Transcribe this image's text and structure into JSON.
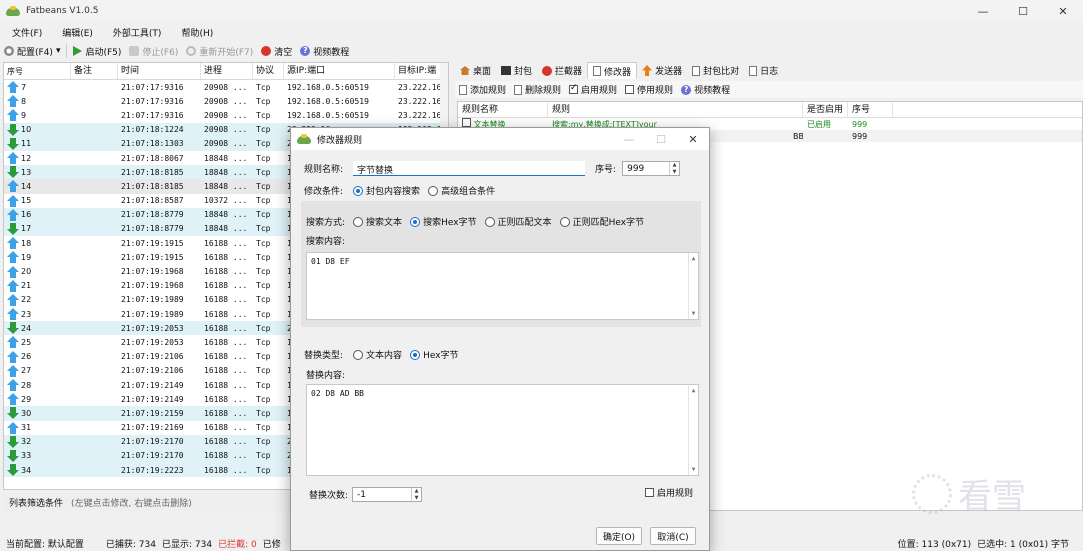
{
  "window": {
    "title": "Fatbeans V1.0.5",
    "minimize_icon": "minimize-icon",
    "maximize_icon": "maximize-icon",
    "close_icon": "close-icon"
  },
  "menu": [
    "文件(F)",
    "编辑(E)",
    "外部工具(T)",
    "帮助(H)"
  ],
  "toolbar": {
    "config": "配置(F4)",
    "start": "启动(F5)",
    "stop": "停止(F6)",
    "restart": "重新开始(F7)",
    "clear": "清空",
    "tutorial": "视频教程"
  },
  "packets": {
    "headers": [
      "序号",
      "备注",
      "时间",
      "进程",
      "协议",
      "源IP:端口",
      "目标IP:端"
    ],
    "rows": [
      {
        "no": "7",
        "dir": "up",
        "time": "21:07:17:9316",
        "proc": "20908 ...",
        "proto": "Tcp",
        "src": "192.168.0.5:60519",
        "dst": "23.222.16"
      },
      {
        "no": "8",
        "dir": "up",
        "time": "21:07:17:9316",
        "proc": "20908 ...",
        "proto": "Tcp",
        "src": "192.168.0.5:60519",
        "dst": "23.222.16"
      },
      {
        "no": "9",
        "dir": "up",
        "time": "21:07:17:9316",
        "proc": "20908 ...",
        "proto": "Tcp",
        "src": "192.168.0.5:60519",
        "dst": "23.222.16"
      },
      {
        "no": "10",
        "dir": "down",
        "time": "21:07:18:1224",
        "proc": "20908 ...",
        "proto": "Tcp",
        "src": "23.222.16",
        "dst": "192.168.0"
      },
      {
        "no": "11",
        "dir": "down",
        "time": "21:07:18:1303",
        "proc": "20908 ...",
        "proto": "Tcp",
        "src": "2",
        "dst": ""
      },
      {
        "no": "12",
        "dir": "up",
        "time": "21:07:18:8067",
        "proc": "18848 ...",
        "proto": "Tcp",
        "src": "1",
        "dst": ""
      },
      {
        "no": "13",
        "dir": "down",
        "time": "21:07:18:8185",
        "proc": "18848 ...",
        "proto": "Tcp",
        "src": "1",
        "dst": ""
      },
      {
        "no": "14",
        "dir": "up",
        "time": "21:07:18:8185",
        "proc": "18848 ...",
        "proto": "Tcp",
        "src": "1",
        "dst": ""
      },
      {
        "no": "15",
        "dir": "up",
        "time": "21:07:18:8587",
        "proc": "10372 ...",
        "proto": "Tcp",
        "src": "1",
        "dst": ""
      },
      {
        "no": "16",
        "dir": "up",
        "time": "21:07:18:8779",
        "proc": "18848 ...",
        "proto": "Tcp",
        "src": "1",
        "dst": ""
      },
      {
        "no": "17",
        "dir": "down",
        "time": "21:07:18:8779",
        "proc": "18848 ...",
        "proto": "Tcp",
        "src": "1",
        "dst": ""
      },
      {
        "no": "18",
        "dir": "up",
        "time": "21:07:19:1915",
        "proc": "16188 ...",
        "proto": "Tcp",
        "src": "1",
        "dst": ""
      },
      {
        "no": "19",
        "dir": "up",
        "time": "21:07:19:1915",
        "proc": "16188 ...",
        "proto": "Tcp",
        "src": "1",
        "dst": ""
      },
      {
        "no": "20",
        "dir": "up",
        "time": "21:07:19:1968",
        "proc": "16188 ...",
        "proto": "Tcp",
        "src": "1",
        "dst": ""
      },
      {
        "no": "21",
        "dir": "up",
        "time": "21:07:19:1968",
        "proc": "16188 ...",
        "proto": "Tcp",
        "src": "1",
        "dst": ""
      },
      {
        "no": "22",
        "dir": "up",
        "time": "21:07:19:1989",
        "proc": "16188 ...",
        "proto": "Tcp",
        "src": "1",
        "dst": ""
      },
      {
        "no": "23",
        "dir": "up",
        "time": "21:07:19:1989",
        "proc": "16188 ...",
        "proto": "Tcp",
        "src": "1",
        "dst": ""
      },
      {
        "no": "24",
        "dir": "down",
        "time": "21:07:19:2053",
        "proc": "16188 ...",
        "proto": "Tcp",
        "src": "2",
        "dst": ""
      },
      {
        "no": "25",
        "dir": "up",
        "time": "21:07:19:2053",
        "proc": "16188 ...",
        "proto": "Tcp",
        "src": "1",
        "dst": ""
      },
      {
        "no": "26",
        "dir": "up",
        "time": "21:07:19:2106",
        "proc": "16188 ...",
        "proto": "Tcp",
        "src": "1",
        "dst": ""
      },
      {
        "no": "27",
        "dir": "up",
        "time": "21:07:19:2106",
        "proc": "16188 ...",
        "proto": "Tcp",
        "src": "1",
        "dst": ""
      },
      {
        "no": "28",
        "dir": "up",
        "time": "21:07:19:2149",
        "proc": "16188 ...",
        "proto": "Tcp",
        "src": "1",
        "dst": ""
      },
      {
        "no": "29",
        "dir": "up",
        "time": "21:07:19:2149",
        "proc": "16188 ...",
        "proto": "Tcp",
        "src": "1",
        "dst": ""
      },
      {
        "no": "30",
        "dir": "down",
        "time": "21:07:19:2159",
        "proc": "16188 ...",
        "proto": "Tcp",
        "src": "1",
        "dst": ""
      },
      {
        "no": "31",
        "dir": "up",
        "time": "21:07:19:2169",
        "proc": "16188 ...",
        "proto": "Tcp",
        "src": "1",
        "dst": ""
      },
      {
        "no": "32",
        "dir": "down",
        "time": "21:07:19:2170",
        "proc": "16188 ...",
        "proto": "Tcp",
        "src": "2",
        "dst": ""
      },
      {
        "no": "33",
        "dir": "down",
        "time": "21:07:19:2170",
        "proc": "16188 ...",
        "proto": "Tcp",
        "src": "2",
        "dst": ""
      },
      {
        "no": "34",
        "dir": "down",
        "time": "21:07:19:2223",
        "proc": "16188 ...",
        "proto": "Tcp",
        "src": "1",
        "dst": ""
      }
    ]
  },
  "filter": {
    "label": "列表筛选条件",
    "hint": "(左键点击修改, 右键点击删除)"
  },
  "tabs": [
    "桌面",
    "封包",
    "拦截器",
    "修改器",
    "发送器",
    "封包比对",
    "日志"
  ],
  "rule_toolbar": {
    "add": "添加规则",
    "delete": "删除规则",
    "enable": "启用规则",
    "disable": "停用规则",
    "tutorial": "视频教程"
  },
  "rules": {
    "headers": [
      "规则名称",
      "规则",
      "是否启用",
      "序号"
    ],
    "rows": [
      {
        "name": "文本替换",
        "rule": "搜索:my,替换成:[TEXT]your",
        "enabled": "已启用",
        "seq": "999"
      },
      {
        "name": "",
        "rule": "BB",
        "enabled": "",
        "seq": "999"
      }
    ]
  },
  "status": {
    "config": "当前配置: 默认配置",
    "captured": "已捕获: 734",
    "shown": "已显示: 734",
    "blocked": "已拦截: 0",
    "truncated": "已修",
    "position": "位置: 113 (0x71)",
    "selected": "已选中: 1 (0x01) 字节"
  },
  "watermark": "看雪",
  "dialog": {
    "title": "修改器规则",
    "rule_name_label": "规则名称:",
    "rule_name_value": "字节替换",
    "seq_label": "序号:",
    "seq_value": "999",
    "condition_label": "修改条件:",
    "condition_options": [
      "封包内容搜索",
      "高级组合条件"
    ],
    "search_mode_label": "搜索方式:",
    "search_modes": [
      "搜索文本",
      "搜索Hex字节",
      "正则匹配文本",
      "正则匹配Hex字节"
    ],
    "search_content_label": "搜索内容:",
    "search_content": "01 D8 EF",
    "replace_type_label": "替换类型:",
    "replace_types": [
      "文本内容",
      "Hex字节"
    ],
    "replace_content_label": "替换内容:",
    "replace_content": "02 D8 AD BB",
    "replace_count_label": "替换次数:",
    "replace_count": "-1",
    "enable_rule": "启用规则",
    "ok": "确定(O)",
    "cancel": "取消(C)"
  }
}
